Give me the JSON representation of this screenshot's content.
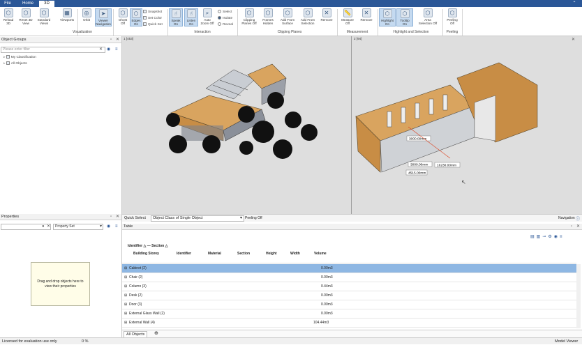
{
  "tabs": [
    "File",
    "Home",
    "3D"
  ],
  "ribbon": {
    "buttons": [
      {
        "id": "reload",
        "label": "Reload\n3D",
        "icon": "cube-icon"
      },
      {
        "id": "reset",
        "label": "Reset 3D\nView",
        "icon": "cube-reset-icon"
      },
      {
        "id": "standard",
        "label": "Standard\nViews",
        "icon": "cube-views-icon"
      },
      {
        "id": "viewports",
        "label": "Viewports",
        "icon": "viewports-icon"
      },
      {
        "id": "orbit",
        "label": "Orbit",
        "icon": "orbit-icon"
      },
      {
        "id": "viewer-nav",
        "label": "Viewer\nNavigation",
        "icon": "navigation-icon"
      },
      {
        "id": "ghost",
        "label": "Ghost\nOff",
        "icon": "ghost-icon"
      },
      {
        "id": "edges",
        "label": "Edges\nOn",
        "icon": "edges-icon"
      },
      {
        "id": "speak",
        "label": "Speak\nOn",
        "icon": "speak-icon"
      },
      {
        "id": "listen",
        "label": "Listen\nOn",
        "icon": "listen-icon"
      },
      {
        "id": "autozoom",
        "label": "Auto\nZoom Off",
        "icon": "zoom-icon"
      },
      {
        "id": "clipplanes",
        "label": "Clipping\nPlanes Off",
        "icon": "clip-icon"
      },
      {
        "id": "frames",
        "label": "Frames\nHidden",
        "icon": "frames-icon"
      },
      {
        "id": "addsurface",
        "label": "Add From\nSurface",
        "icon": "add-surface-icon"
      },
      {
        "id": "addselection",
        "label": "Add From\nSelection",
        "icon": "add-selection-icon"
      },
      {
        "id": "remove1",
        "label": "Remove",
        "icon": "remove-icon"
      },
      {
        "id": "measure",
        "label": "Measure\nOff",
        "icon": "measure-icon"
      },
      {
        "id": "remove2",
        "label": "Remove",
        "icon": "remove-icon"
      },
      {
        "id": "highlight",
        "label": "Highlight\nOn",
        "icon": "highlight-icon"
      },
      {
        "id": "tooltip",
        "label": "Tooltip\nOn",
        "icon": "tooltip-icon"
      },
      {
        "id": "area",
        "label": "Area\nSelection Off",
        "icon": "area-icon"
      },
      {
        "id": "peeling",
        "label": "Peeling\nOff",
        "icon": "peeling-icon"
      }
    ],
    "small": {
      "snapshot": "Snapshot",
      "setcolor": "Set Color",
      "quickset": "Quick Set",
      "select": "Select",
      "isolate": "Isolate",
      "reveal": "Reveal"
    },
    "groups": {
      "visualization": "Visualization",
      "interaction": "Interaction",
      "clipping": "Clipping Planes",
      "measurement": "Measurement",
      "highlight": "Highlight and Selection",
      "peeling": "Peeling"
    }
  },
  "object_groups": {
    "title": "Object Groups",
    "filter_placeholder": "Please enter filter",
    "items": [
      "My Classification",
      "All Objects"
    ]
  },
  "properties": {
    "title": "Properties",
    "property_set": "Property Set",
    "drop_hint": "Drag and drop objects here to view their properties"
  },
  "viewport": {
    "left_label": "1 [453]",
    "right_label": "2 [94]",
    "dims": [
      "3000.00mm",
      "3000.00mm",
      "16230.00mm",
      "4515.00mm"
    ]
  },
  "quick_select": {
    "label": "Quick Select",
    "value": "Object Class of Single Object",
    "peeling": "Peeling Off",
    "navigation": "Navigation"
  },
  "table": {
    "title": "Table",
    "grouping": "Identifier △ — Section △",
    "columns": [
      "Building Storey",
      "Identifier",
      "Material",
      "Section",
      "Height",
      "Width",
      "Volume"
    ],
    "rows": [
      {
        "name": "Cabinet (2)",
        "volume": "0.00m3"
      },
      {
        "name": "Chair (2)",
        "volume": "0.00m3"
      },
      {
        "name": "Column (3)",
        "volume": "0.44m3"
      },
      {
        "name": "Desk (2)",
        "volume": "0.00m3"
      },
      {
        "name": "Door (3)",
        "volume": "0.00m3"
      },
      {
        "name": "External Glass Wall (2)",
        "volume": "0.00m3"
      },
      {
        "name": "External Wall (4)",
        "volume": "104.44m3"
      }
    ],
    "footer_tab": "All Objects"
  },
  "status": {
    "license": "Licensed for evaluation use only",
    "progress": "0 %",
    "viewer": "Model Viewer"
  },
  "colors": {
    "accent": "#2b5797",
    "selected_row": "#8eb7e3",
    "toggle_on": "#c5daf0",
    "model_wood": "#d9a45f"
  }
}
